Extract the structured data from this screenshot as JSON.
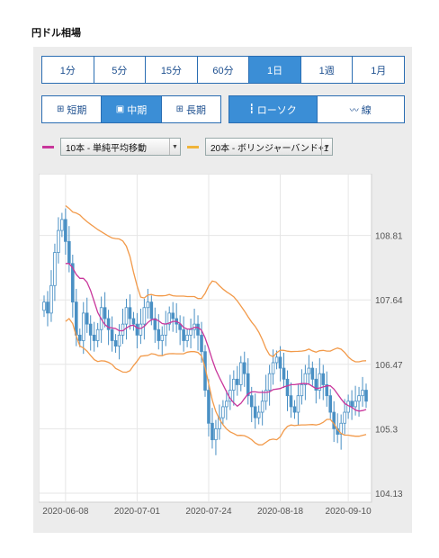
{
  "page": {
    "title": "円ドル相場"
  },
  "timeframes": [
    "1分",
    "5分",
    "15分",
    "60分",
    "1日",
    "1週",
    "1月"
  ],
  "active_timeframe_index": 4,
  "term_buttons": [
    {
      "label": "短期",
      "icon": "range-icon"
    },
    {
      "label": "中期",
      "icon": "range-icon"
    },
    {
      "label": "長期",
      "icon": "range-icon"
    }
  ],
  "active_term_index": 1,
  "chart_type_buttons": [
    {
      "label": "ローソク",
      "icon": "candlestick-icon"
    },
    {
      "label": "線",
      "icon": "line-chart-icon"
    }
  ],
  "active_chart_type_index": 0,
  "indicators": {
    "ma": {
      "value": "10本 - 単純平均移動",
      "color": "#c9369b"
    },
    "bb": {
      "value": "20本 - ボリンジャーバンド+1",
      "color": "#f0b43a"
    }
  },
  "colors": {
    "accent": "#3b8ed6",
    "candle": "#4a90c4",
    "ma": "#c9369b",
    "band": "#f29a4a"
  },
  "chart_data": {
    "type": "candlestick",
    "x_tick_labels": [
      "2020-06-08",
      "2020-07-01",
      "2020-07-24",
      "2020-08-18",
      "2020-09-10"
    ],
    "y_tick_labels": [
      "108.81",
      "107.64",
      "106.47",
      "105.3",
      "104.13"
    ],
    "ylim": [
      104.13,
      109.8
    ],
    "grid": true,
    "close": [
      107.6,
      107.4,
      107.9,
      108.5,
      108.9,
      109.1,
      108.7,
      108.3,
      107.6,
      107.0,
      106.9,
      107.4,
      107.2,
      107.0,
      106.9,
      107.1,
      107.5,
      107.3,
      107.1,
      106.9,
      106.8,
      107.0,
      107.2,
      107.5,
      107.3,
      107.2,
      107.0,
      107.2,
      107.5,
      107.6,
      107.3,
      107.1,
      106.9,
      107.0,
      107.2,
      107.4,
      107.3,
      107.2,
      107.1,
      106.9,
      107.0,
      107.1,
      107.2,
      107.0,
      106.7,
      106.0,
      105.4,
      105.1,
      105.3,
      105.5,
      105.7,
      105.8,
      106.0,
      106.2,
      106.1,
      106.5,
      106.3,
      105.9,
      105.7,
      105.5,
      105.6,
      105.8,
      106.0,
      106.3,
      106.5,
      106.6,
      106.4,
      106.2,
      105.9,
      105.7,
      105.6,
      105.9,
      106.1,
      106.3,
      106.4,
      106.2,
      106.0,
      106.3,
      106.1,
      105.9,
      105.6,
      105.3,
      105.2,
      105.4,
      105.6,
      105.8,
      105.7,
      105.8,
      105.9,
      106.0,
      105.8
    ]
  }
}
